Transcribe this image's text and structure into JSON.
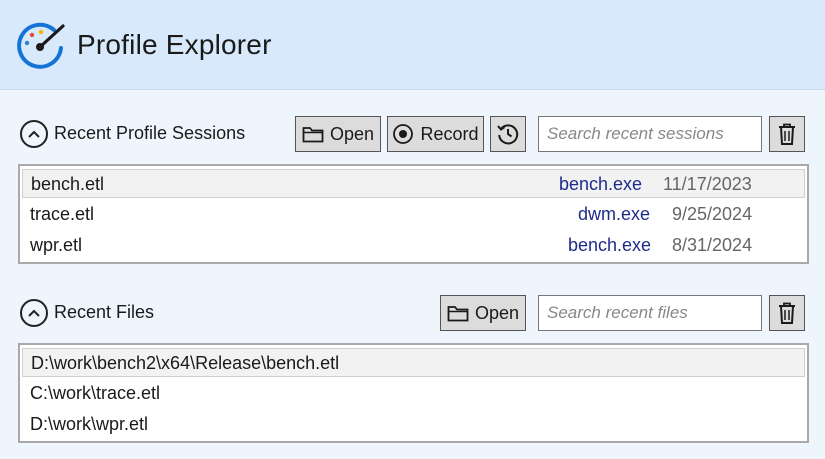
{
  "app": {
    "title": "Profile Explorer"
  },
  "sessions": {
    "section_label": "Recent Profile Sessions",
    "open_label": "Open",
    "record_label": "Record",
    "search_placeholder": "Search recent sessions",
    "items": [
      {
        "name": "bench.etl",
        "process": "bench.exe",
        "date": "11/17/2023",
        "selected": true
      },
      {
        "name": "trace.etl",
        "process": "dwm.exe",
        "date": "9/25/2024",
        "selected": false
      },
      {
        "name": "wpr.etl",
        "process": "bench.exe",
        "date": "8/31/2024",
        "selected": false
      }
    ]
  },
  "files": {
    "section_label": "Recent Files",
    "open_label": "Open",
    "search_placeholder": "Search recent files",
    "items": [
      {
        "path": "D:\\work\\bench2\\x64\\Release\\bench.etl",
        "selected": true
      },
      {
        "path": "C:\\work\\trace.etl",
        "selected": false
      },
      {
        "path": "D:\\work\\wpr.etl",
        "selected": false
      }
    ]
  },
  "icons": {
    "logo": "gauge-icon",
    "collapse": "chevron-up-icon",
    "folder": "folder-icon",
    "record": "record-icon",
    "history": "history-icon",
    "delete": "trash-icon"
  },
  "colors": {
    "header_bg": "#d7e9fa",
    "page_bg": "#eef5fc",
    "process_text": "#1e2b8a",
    "logo_blue": "#1473d6"
  }
}
